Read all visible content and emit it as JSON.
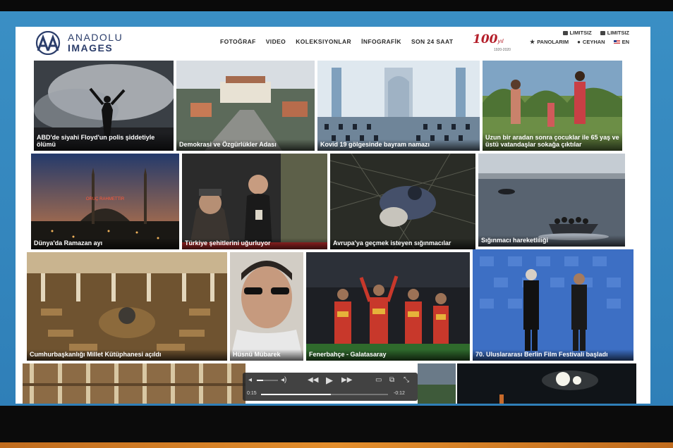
{
  "brand": {
    "line1": "ANADOLU",
    "line2": "IMAGES"
  },
  "nav": [
    "FOTOĞRAF",
    "VIDEO",
    "KOLEKSIYONLAR",
    "İNFOGRAFİK",
    "SON 24 SAAT"
  ],
  "anniversary": {
    "number": "100",
    "suffix": "yıl",
    "years": "1920-2020"
  },
  "utility": {
    "row1": [
      "LIMITSIZ",
      "LIMITSIZ"
    ],
    "row2": [
      "PANOLARIM",
      "CEYHAN",
      "EN"
    ]
  },
  "tiles": [
    {
      "caption": "ABD'de siyahi Floyd'un polis şiddetiyle ölümü"
    },
    {
      "caption": "Demokrasi ve Özgürlükler Adası"
    },
    {
      "caption": "Kovid 19 gölgesinde bayram namazı"
    },
    {
      "caption": "Uzun bir aradan sonra çocuklar ile 65 yaş ve üstü vatandaşlar sokağa çıktılar"
    },
    {
      "caption": "Dünya'da Ramazan ayı"
    },
    {
      "caption": "Türkiye şehitlerini uğurluyor"
    },
    {
      "caption": "Avrupa'ya geçmek isteyen sığınmacılar"
    },
    {
      "caption": "Sığınmacı hareketliliği"
    },
    {
      "caption": "Cumhurbaşkanlığı Millet Kütüphanesi açıldı"
    },
    {
      "caption": "Hüsnü Mübarek"
    },
    {
      "caption": "Fenerbahçe - Galatasaray"
    },
    {
      "caption": "70. Uluslararası Berlin Film Festivali başladı"
    }
  ],
  "player": {
    "elapsed": "0:15",
    "remaining": "-0:12",
    "progress": 0.55,
    "volume": 0.3
  },
  "colors": {
    "screen_blue": "#3a8fc4",
    "accent_red": "#b41f2a",
    "brand_navy": "#2c3e6b"
  }
}
